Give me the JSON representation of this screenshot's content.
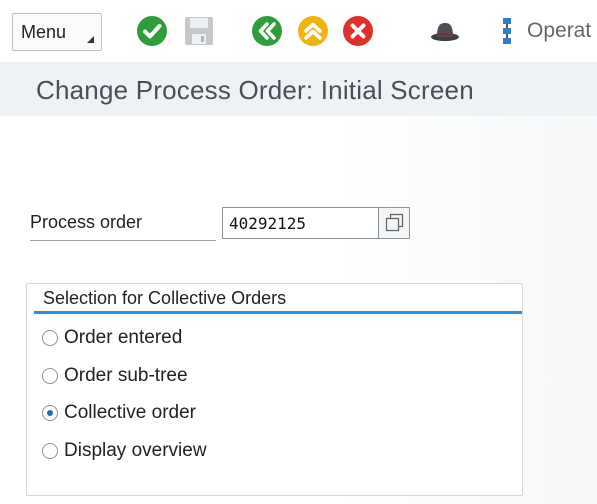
{
  "toolbar": {
    "menu_label": "Menu",
    "operations_label": "Operat",
    "icons": {
      "enter": "check-circle-icon",
      "save": "floppy-save-icon",
      "back": "double-chevron-left-icon",
      "exit": "double-chevron-up-icon",
      "cancel": "close-circle-icon",
      "hat": "hat-icon",
      "operations": "operations-icon"
    },
    "colors": {
      "enter": "#2e9e3a",
      "save": "#b5bac0",
      "back": "#2e9e3a",
      "exit": "#f0b30f",
      "cancel": "#e0302d"
    }
  },
  "page": {
    "title": "Change Process Order: Initial Screen"
  },
  "form": {
    "process_order_label": "Process order",
    "process_order_value": "40292125",
    "value_help_icon": "value-help-icon"
  },
  "selection": {
    "title": "Selection for Collective Orders",
    "accent_color": "#2f8fd8",
    "options": [
      {
        "label": "Order entered",
        "checked": false
      },
      {
        "label": "Order sub-tree",
        "checked": false
      },
      {
        "label": "Collective order",
        "checked": true
      },
      {
        "label": "Display overview",
        "checked": false
      }
    ]
  }
}
